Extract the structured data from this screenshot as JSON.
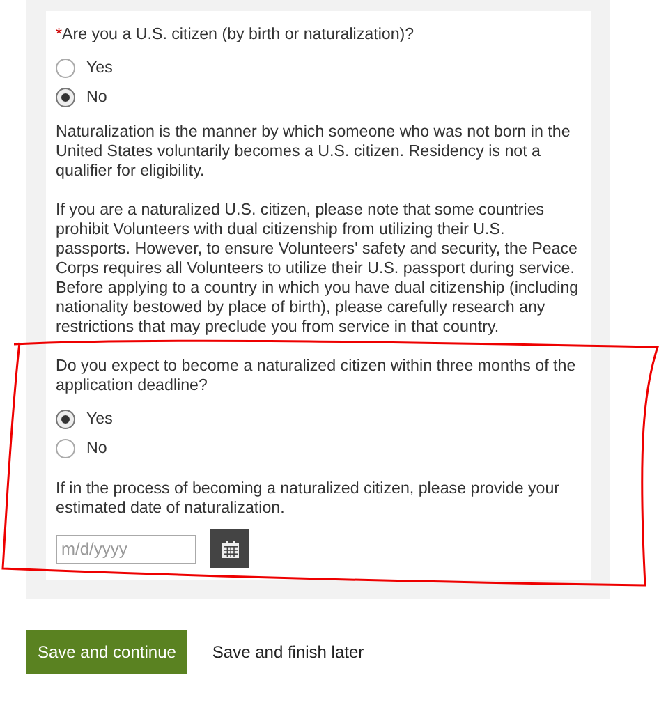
{
  "questions": [
    {
      "required_mark": "*",
      "label": "Are you a U.S. citizen (by birth or naturalization)?",
      "options": [
        {
          "label": "Yes",
          "selected": false
        },
        {
          "label": "No",
          "selected": true
        }
      ],
      "notes": [
        "Naturalization is the manner by which someone who was not born in the United States voluntarily becomes a U.S. citizen. Residency is not a qualifier for eligibility.",
        "If you are a naturalized U.S. citizen, please note that some countries prohibit Volunteers with dual citizenship from utilizing their U.S. passports. However, to ensure Volunteers' safety and security, the Peace Corps requires all Volunteers to utilize their U.S. passport during service. Before applying to a country in which you have dual citizenship (including nationality bestowed by place of birth), please carefully research any restrictions that may preclude you from service in that country."
      ]
    },
    {
      "label": "Do you expect to become a naturalized citizen within three months of the application deadline?",
      "options": [
        {
          "label": "Yes",
          "selected": true
        },
        {
          "label": "No",
          "selected": false
        }
      ],
      "date_prompt": "If in the process of becoming a naturalized citizen, please provide your estimated date of naturalization.",
      "date_field": {
        "placeholder": "m/d/yyyy"
      }
    }
  ],
  "annotation": {
    "kind": "outline"
  },
  "actions": {
    "primary": "Save and continue",
    "secondary": "Save and finish later"
  }
}
